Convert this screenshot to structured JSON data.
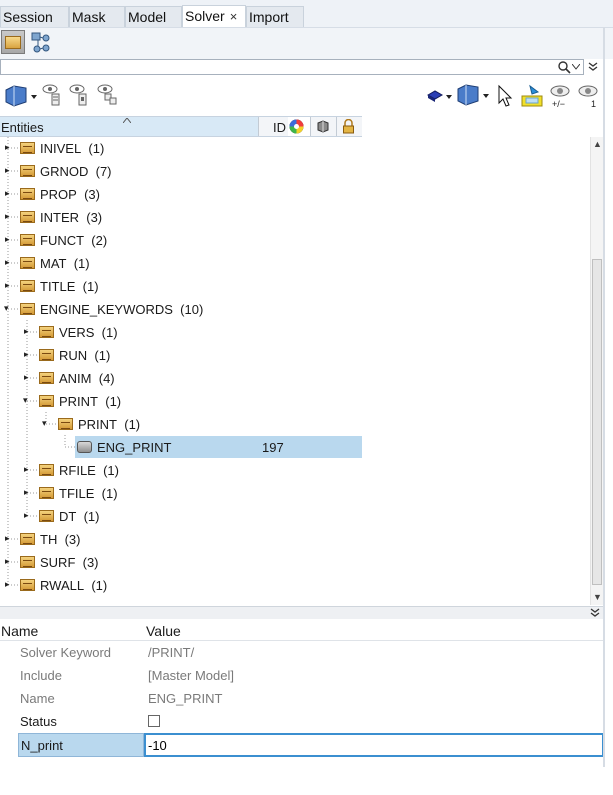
{
  "tabs": [
    {
      "label": "Session"
    },
    {
      "label": "Mask"
    },
    {
      "label": "Model"
    },
    {
      "label": "Solver",
      "close": "×"
    },
    {
      "label": "Import"
    }
  ],
  "entities_header": {
    "entities": "Entities",
    "id": "ID"
  },
  "tree": [
    {
      "label": "INIVEL",
      "count": "(1)"
    },
    {
      "label": "GRNOD",
      "count": "(7)"
    },
    {
      "label": "PROP",
      "count": "(3)"
    },
    {
      "label": "INTER",
      "count": "(3)"
    },
    {
      "label": "FUNCT",
      "count": "(2)"
    },
    {
      "label": "MAT",
      "count": "(1)"
    },
    {
      "label": "TITLE",
      "count": "(1)"
    },
    {
      "label": "ENGINE_KEYWORDS",
      "count": "(10)"
    },
    {
      "label": "VERS",
      "count": "(1)"
    },
    {
      "label": "RUN",
      "count": "(1)"
    },
    {
      "label": "ANIM",
      "count": "(4)"
    },
    {
      "label": "PRINT",
      "count": "(1)"
    },
    {
      "label": "PRINT",
      "count": "(1)"
    },
    {
      "label": "ENG_PRINT",
      "count": "",
      "id": "197"
    },
    {
      "label": "RFILE",
      "count": "(1)"
    },
    {
      "label": "TFILE",
      "count": "(1)"
    },
    {
      "label": "DT",
      "count": "(1)"
    },
    {
      "label": "TH",
      "count": "(3)"
    },
    {
      "label": "SURF",
      "count": "(3)"
    },
    {
      "label": "RWALL",
      "count": "(1)"
    }
  ],
  "props_header": {
    "name": "Name",
    "value": "Value"
  },
  "props": [
    {
      "name": "Solver Keyword",
      "value": "/PRINT/"
    },
    {
      "name": "Include",
      "value": "[Master Model]"
    },
    {
      "name": "Name",
      "value": "ENG_PRINT"
    },
    {
      "name": "Status",
      "value": ""
    }
  ],
  "n_print": {
    "name": "N_print",
    "value": "-10"
  },
  "status_checked": false,
  "colors": {
    "selection": "#b9d8ee",
    "tab_bg": "#eef2f7",
    "accent": "#3b8fd0"
  },
  "icons": [
    "folder-icon",
    "graph-icon",
    "search-icon",
    "chevron-down-icon",
    "eye-icon",
    "cursor-icon",
    "lock-icon",
    "color-wheel-icon"
  ]
}
